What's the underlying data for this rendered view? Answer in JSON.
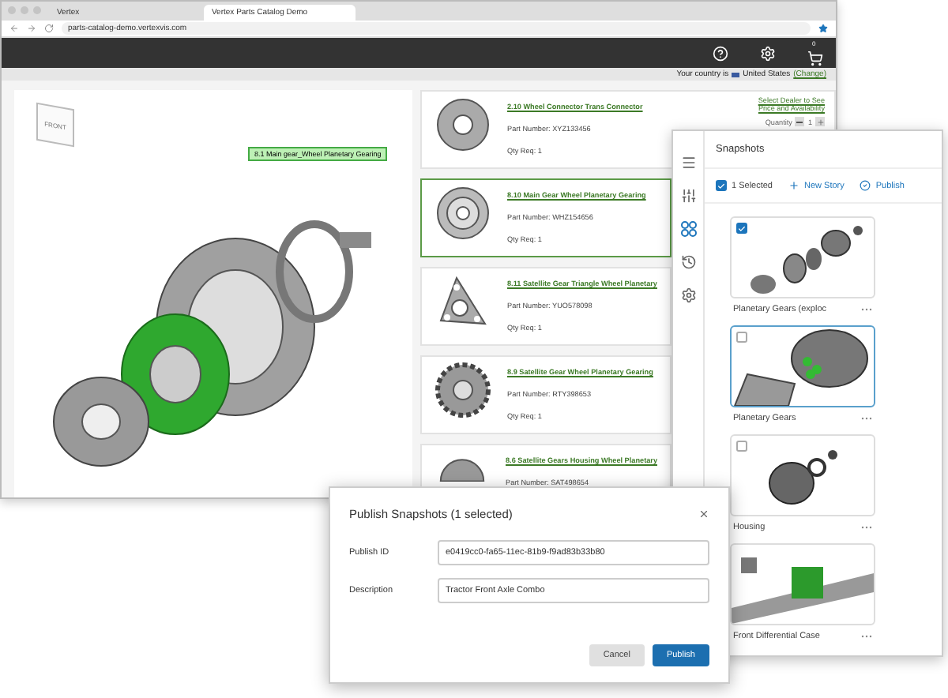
{
  "browser": {
    "tabs": [
      {
        "label": "Vertex",
        "selected": false
      },
      {
        "label": "Vertex Parts Catalog Demo",
        "selected": true
      }
    ],
    "url": "parts-catalog-demo.vertexvis.com"
  },
  "header": {
    "cart_count": "0",
    "country_label": "Your country is",
    "country": "United States",
    "change_link": "(Change)"
  },
  "viewer": {
    "cube_label": "FRONT",
    "callout": "8.1 Main gear_Wheel Planetary Gearing"
  },
  "dealer_link": "Select Dealer to See Price and Availability",
  "quantity_label": "Quantity",
  "quantity": "1",
  "parts": [
    {
      "title": "2.10 Wheel Connector Trans Connector",
      "part_number": "Part Number: XYZ133456",
      "qty": "Qty Req: 1",
      "selected": false
    },
    {
      "title": "8.10 Main Gear Wheel Planetary Gearing",
      "part_number": "Part Number: WHZ154656",
      "qty": "Qty Req: 1",
      "selected": true
    },
    {
      "title": "8.11 Satellite Gear Triangle Wheel Planetary",
      "part_number": "Part Number: YUO578098",
      "qty": "Qty Req: 1",
      "selected": false
    },
    {
      "title": "8.9 Satellite Gear Wheel Planetary Gearing",
      "part_number": "Part Number: RTY398653",
      "qty": "Qty Req: 1",
      "selected": false
    },
    {
      "title": "8.6 Satellite Gears Housing Wheel Planetary",
      "part_number": "Part Number: SAT498654",
      "selected": false
    }
  ],
  "snapshots": {
    "rail": [
      {
        "kind": "menu",
        "selected": false
      },
      {
        "kind": "sliders",
        "selected": false
      },
      {
        "kind": "grid",
        "selected": true
      },
      {
        "kind": "history",
        "selected": false
      },
      {
        "kind": "settings",
        "selected": false
      }
    ],
    "title": "Snapshots",
    "all_checked": true,
    "selected_count": "1 Selected",
    "new_story": "New Story",
    "publish": "Publish",
    "items": [
      {
        "label": "Planetary Gears (exploc",
        "checked": true,
        "highlighted": false
      },
      {
        "label": "Planetary Gears",
        "checked": false,
        "highlighted": true
      },
      {
        "label": "Housing",
        "checked": false,
        "highlighted": false
      },
      {
        "label": "Front Differential Case",
        "highlighted": false
      }
    ]
  },
  "dialog": {
    "title": "Publish Snapshots (1 selected)",
    "fields": [
      {
        "label": "Publish ID",
        "value": "e0419cc0-fa65-11ec-81b9-f9ad83b33b80"
      },
      {
        "label": "Description",
        "value": "Tractor Front Axle Combo"
      }
    ],
    "buttons": [
      {
        "label": "Cancel",
        "kind": "secondary"
      },
      {
        "label": "Publish",
        "kind": "primary"
      }
    ]
  }
}
